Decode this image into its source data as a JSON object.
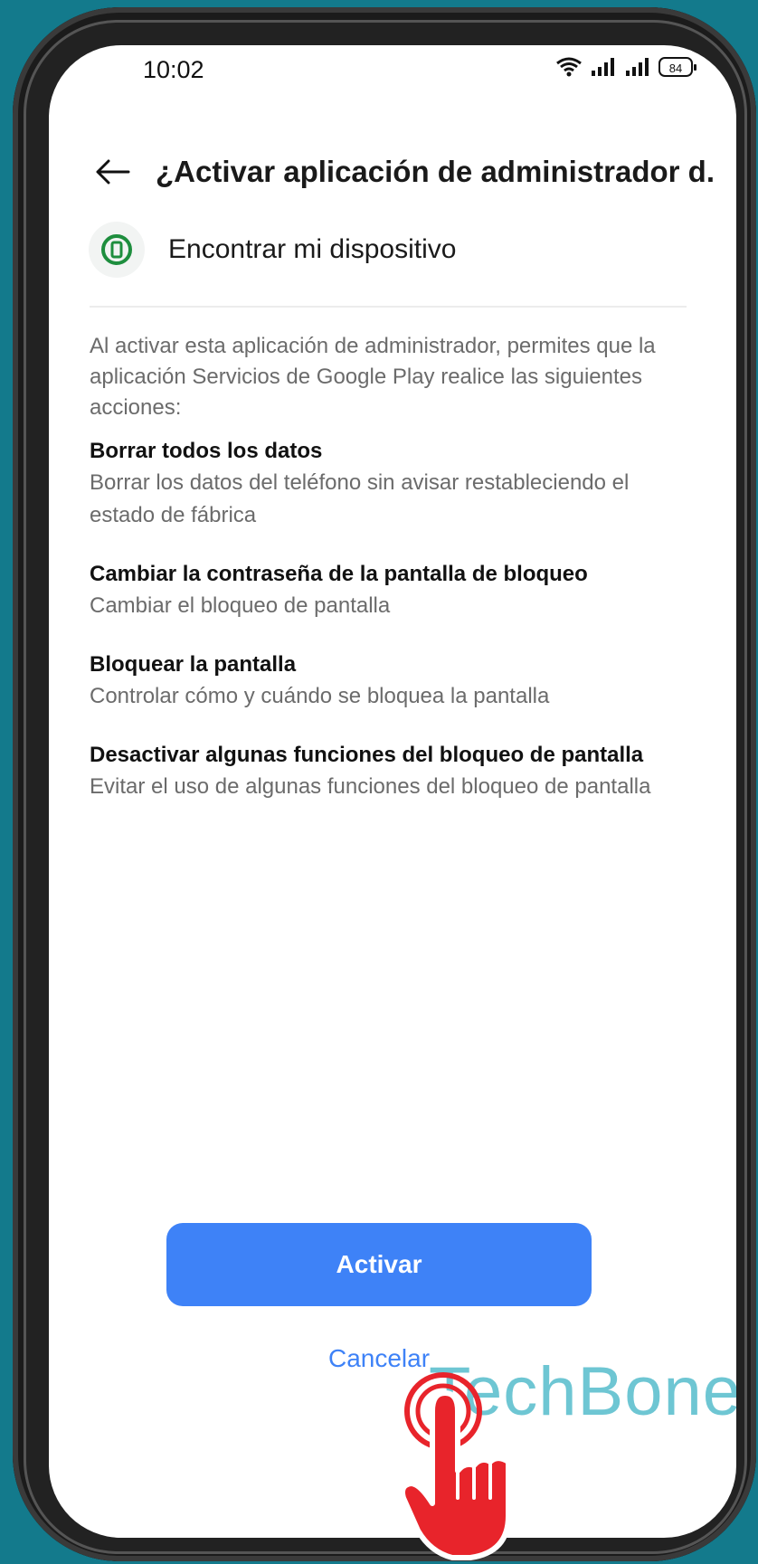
{
  "status_bar": {
    "time": "10:02",
    "battery": "84"
  },
  "header": {
    "title": "¿Activar aplicación de administrador d..."
  },
  "app": {
    "name": "Encontrar mi dispositivo"
  },
  "intro": "Al activar esta aplicación de administrador, permites que la aplicación Servicios de Google Play realice las siguientes acciones:",
  "permissions": [
    {
      "title": "Borrar todos los datos",
      "description": "Borrar los datos del teléfono sin avisar restableciendo el estado de fábrica"
    },
    {
      "title": "Cambiar la contraseña de la pantalla de bloqueo",
      "description": "Cambiar el bloqueo de pantalla"
    },
    {
      "title": "Bloquear la pantalla",
      "description": "Controlar cómo y cuándo se bloquea la pantalla"
    },
    {
      "title": "Desactivar algunas funciones del bloqueo de pantalla",
      "description": "Evitar el uso de algunas funciones del bloqueo de pantalla"
    }
  ],
  "buttons": {
    "activate": "Activar",
    "cancel": "Cancelar"
  },
  "watermark": "TechBone",
  "colors": {
    "accent": "#3e82f7",
    "tap_indicator": "#e8242b",
    "app_icon": "#1e8e3e"
  }
}
